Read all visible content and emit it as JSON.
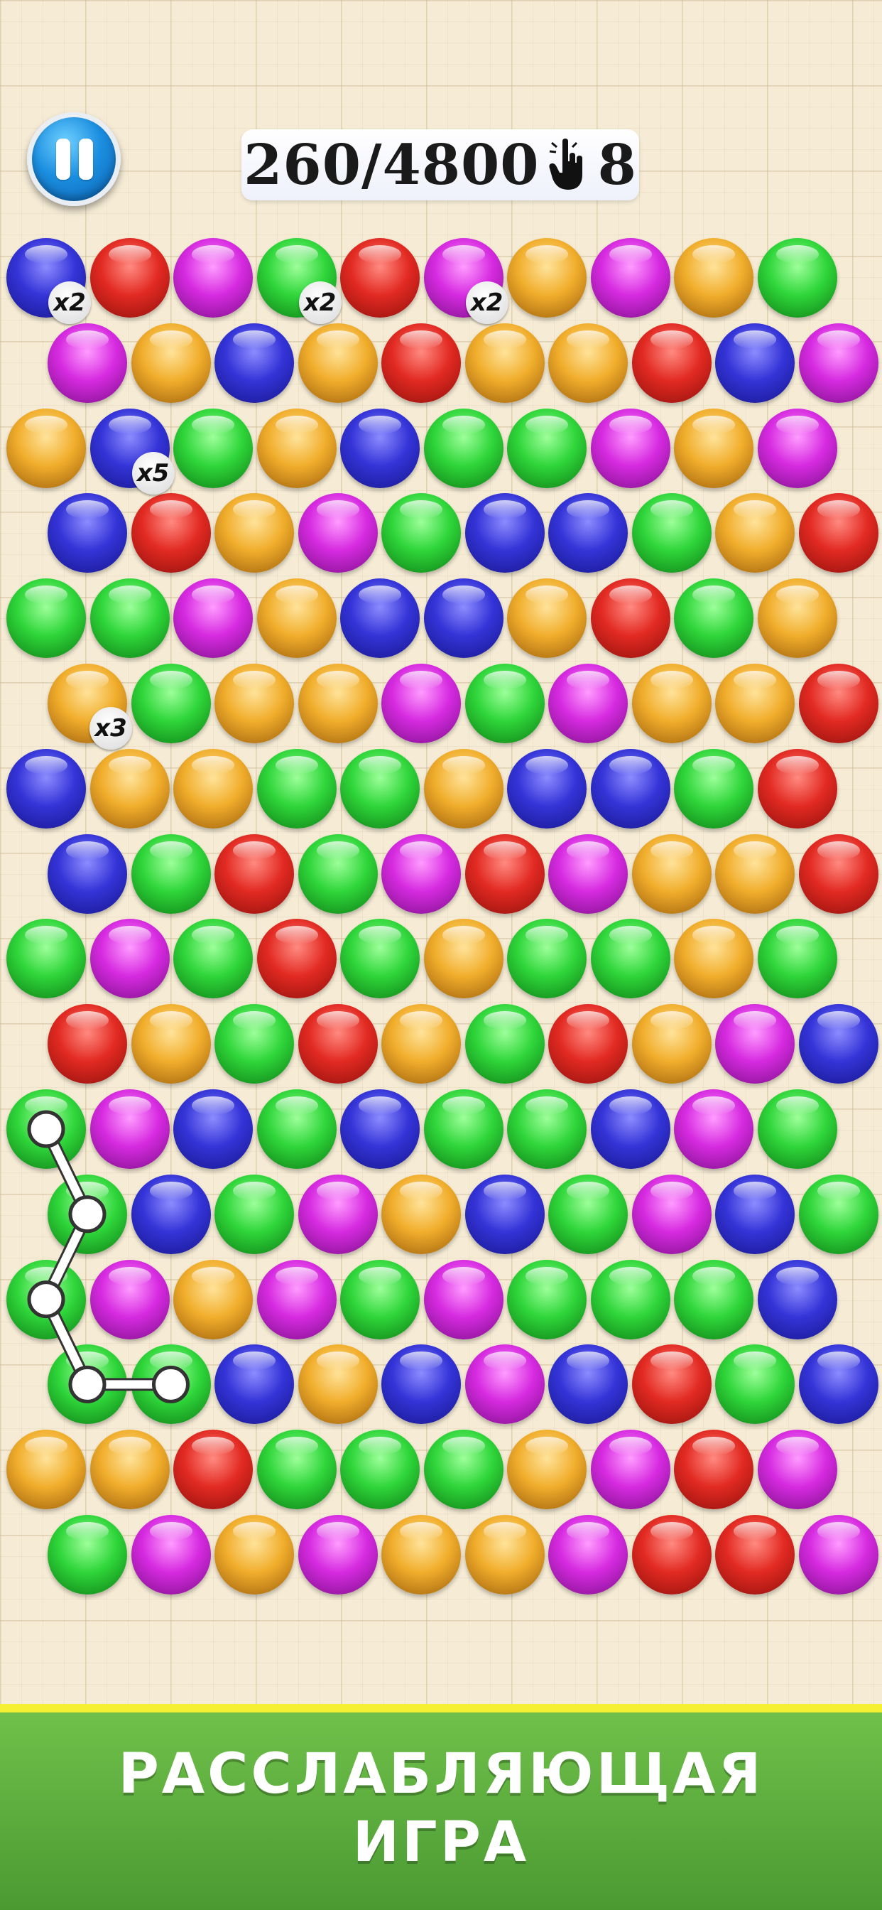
{
  "hud": {
    "pause_icon": "pause-icon",
    "score": "260/4800",
    "tap_icon": "hand-pointer-icon",
    "moves": "8"
  },
  "board": {
    "rows": [
      [
        "blue",
        "red",
        "magenta",
        "green",
        "red",
        "magenta",
        "orange",
        "magenta",
        "orange",
        "green"
      ],
      [
        "magenta",
        "orange",
        "blue",
        "orange",
        "red",
        "orange",
        "orange",
        "red",
        "blue",
        "magenta"
      ],
      [
        "orange",
        "blue",
        "green",
        "orange",
        "blue",
        "green",
        "green",
        "magenta",
        "orange",
        "magenta"
      ],
      [
        "blue",
        "red",
        "orange",
        "magenta",
        "green",
        "blue",
        "blue",
        "green",
        "orange",
        "red"
      ],
      [
        "green",
        "green",
        "magenta",
        "orange",
        "blue",
        "blue",
        "orange",
        "red",
        "green",
        "orange"
      ],
      [
        "orange",
        "green",
        "orange",
        "orange",
        "magenta",
        "green",
        "magenta",
        "orange",
        "orange",
        "red"
      ],
      [
        "blue",
        "orange",
        "orange",
        "green",
        "green",
        "orange",
        "blue",
        "blue",
        "green",
        "red"
      ],
      [
        "blue",
        "green",
        "red",
        "green",
        "magenta",
        "red",
        "magenta",
        "orange",
        "orange",
        "red"
      ],
      [
        "green",
        "magenta",
        "green",
        "red",
        "green",
        "orange",
        "green",
        "green",
        "orange",
        "green"
      ],
      [
        "red",
        "orange",
        "green",
        "red",
        "orange",
        "green",
        "red",
        "orange",
        "magenta",
        "blue"
      ],
      [
        "green",
        "magenta",
        "blue",
        "green",
        "blue",
        "green",
        "green",
        "blue",
        "magenta",
        "green"
      ],
      [
        "green",
        "blue",
        "green",
        "magenta",
        "orange",
        "blue",
        "green",
        "magenta",
        "blue",
        "green"
      ],
      [
        "green",
        "magenta",
        "orange",
        "magenta",
        "green",
        "magenta",
        "green",
        "green",
        "green",
        "blue"
      ],
      [
        "green",
        "green",
        "blue",
        "orange",
        "blue",
        "magenta",
        "blue",
        "red",
        "green",
        "blue"
      ],
      [
        "orange",
        "orange",
        "red",
        "green",
        "green",
        "green",
        "orange",
        "magenta",
        "red",
        "magenta"
      ],
      [
        "green",
        "magenta",
        "orange",
        "magenta",
        "orange",
        "orange",
        "magenta",
        "red",
        "red",
        "magenta"
      ]
    ],
    "multipliers": [
      {
        "row": 0,
        "col": 0,
        "label": "x2"
      },
      {
        "row": 0,
        "col": 3,
        "label": "x2"
      },
      {
        "row": 0,
        "col": 5,
        "label": "x2"
      },
      {
        "row": 2,
        "col": 1,
        "label": "x5"
      },
      {
        "row": 5,
        "col": 0,
        "label": "x3"
      }
    ],
    "selected_path": [
      [
        10,
        0
      ],
      [
        11,
        0
      ],
      [
        12,
        0
      ],
      [
        13,
        0
      ],
      [
        13,
        1
      ]
    ]
  },
  "banner": {
    "line1": "РАССЛАБЛЯЮЩАЯ",
    "line2": "ИГРА"
  },
  "colors": {
    "blue": "#3434d8",
    "red": "#e22a22",
    "magenta": "#d62ae0",
    "green": "#2fd63a",
    "orange": "#f1ae2c",
    "banner_green": "#5aad3d",
    "banner_stripe": "#f6f032"
  }
}
